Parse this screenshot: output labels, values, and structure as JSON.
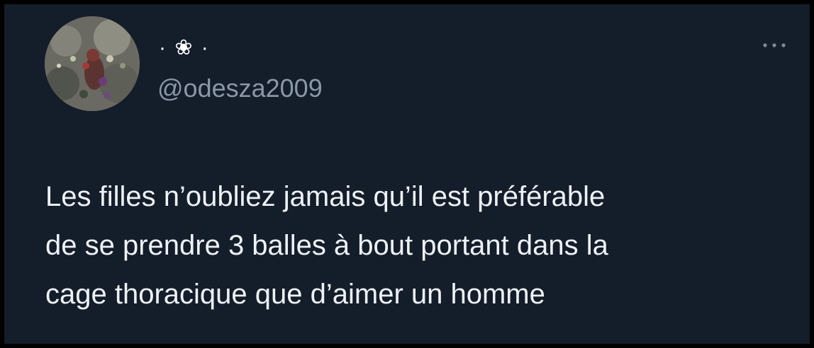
{
  "tweet": {
    "display_name": "· ❀ ·",
    "handle": "@odesza2009",
    "text_lines": [
      "Les filles n’oubliez jamais qu’il est préférable",
      "de se prendre 3 balles à bout portant dans la",
      "cage thoracique que d’aimer un homme"
    ],
    "more_icon": "more-horizontal-icon"
  },
  "colors": {
    "background": "#141d2a",
    "text": "#eef2f5",
    "handle": "#8a97a6"
  }
}
